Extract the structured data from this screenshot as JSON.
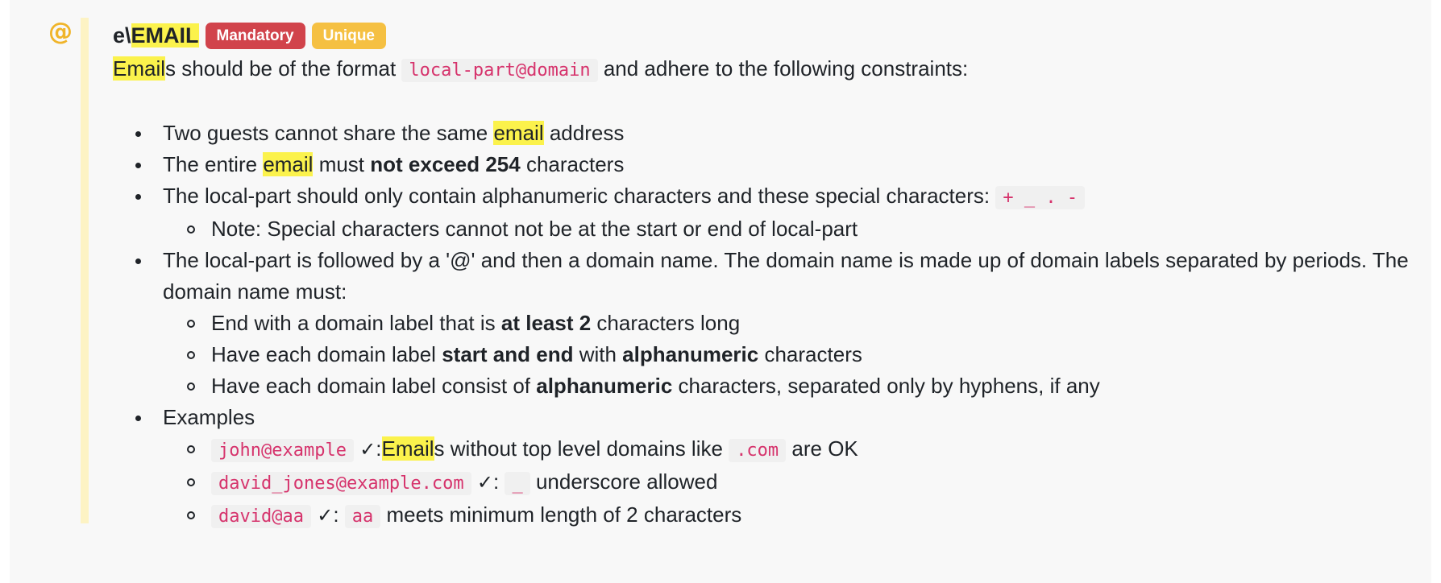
{
  "field": {
    "icon": "at-icon",
    "title_prefix": "e\\",
    "title_highlight": "EMAIL",
    "badges": [
      "Mandatory",
      "Unique"
    ],
    "description": {
      "hl": "Email",
      "rest1": "s should be of the format",
      "code": "local-part@domain",
      "rest2": "and adhere to the following constraints:"
    }
  },
  "constraints": {
    "unique": {
      "pre": "Two guests cannot share the same",
      "hl": "email",
      "post": "address"
    },
    "length": {
      "pre": "The entire",
      "hl": "email",
      "mid": "must",
      "bold": "not exceed 254",
      "post": "characters"
    },
    "localpart": {
      "text": "The local-part should only contain alphanumeric characters and these special characters:",
      "code": "+ _ . -",
      "note": "Note: Special characters cannot not be at the start or end of local-part"
    },
    "domain": {
      "text": "The local-part is followed by a '@' and then a domain name. The domain name is made up of domain labels separated by periods. The domain name must:",
      "rule1": {
        "pre": "End with a domain label that is",
        "bold": "at least 2",
        "post": "characters long"
      },
      "rule2": {
        "pre": "Have each domain label",
        "bold1": "start and end",
        "mid": "with",
        "bold2": "alphanumeric",
        "post": "characters"
      },
      "rule3": {
        "pre": "Have each domain label consist of",
        "bold": "alphanumeric",
        "post": "characters, separated only by hyphens, if any"
      }
    }
  },
  "examples": {
    "label": "Examples",
    "check": "✓",
    "ex1": {
      "code": "john@example",
      "sep": ":",
      "hl": "Email",
      "text": "s without top level domains like",
      "code2": ".com",
      "post": "are OK"
    },
    "ex2": {
      "code": "david_jones@example.com",
      "sep": ":",
      "code2": "_",
      "post": "underscore allowed"
    },
    "ex3": {
      "code": "david@aa",
      "sep": ":",
      "code2": "aa",
      "post": "meets minimum length of 2 characters"
    }
  }
}
